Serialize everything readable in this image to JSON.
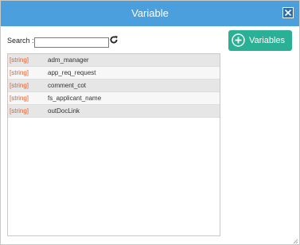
{
  "dialog": {
    "title": "Variable",
    "close_icon": "close-icon",
    "accent_color": "#4a9fdc"
  },
  "search": {
    "label": "Search :",
    "value": "",
    "placeholder": "",
    "refresh_icon": "refresh-icon"
  },
  "add_button": {
    "label": "Variables",
    "icon": "plus-circle-icon",
    "color": "#2ab095"
  },
  "variables": [
    {
      "type": "[string]",
      "name": "adm_manager"
    },
    {
      "type": "[string]",
      "name": "app_req_request"
    },
    {
      "type": "[string]",
      "name": "comment_cot"
    },
    {
      "type": "[string]",
      "name": "fs_applicant_name"
    },
    {
      "type": "[string]",
      "name": "outDocLink"
    }
  ],
  "type_color": "#e0602a"
}
